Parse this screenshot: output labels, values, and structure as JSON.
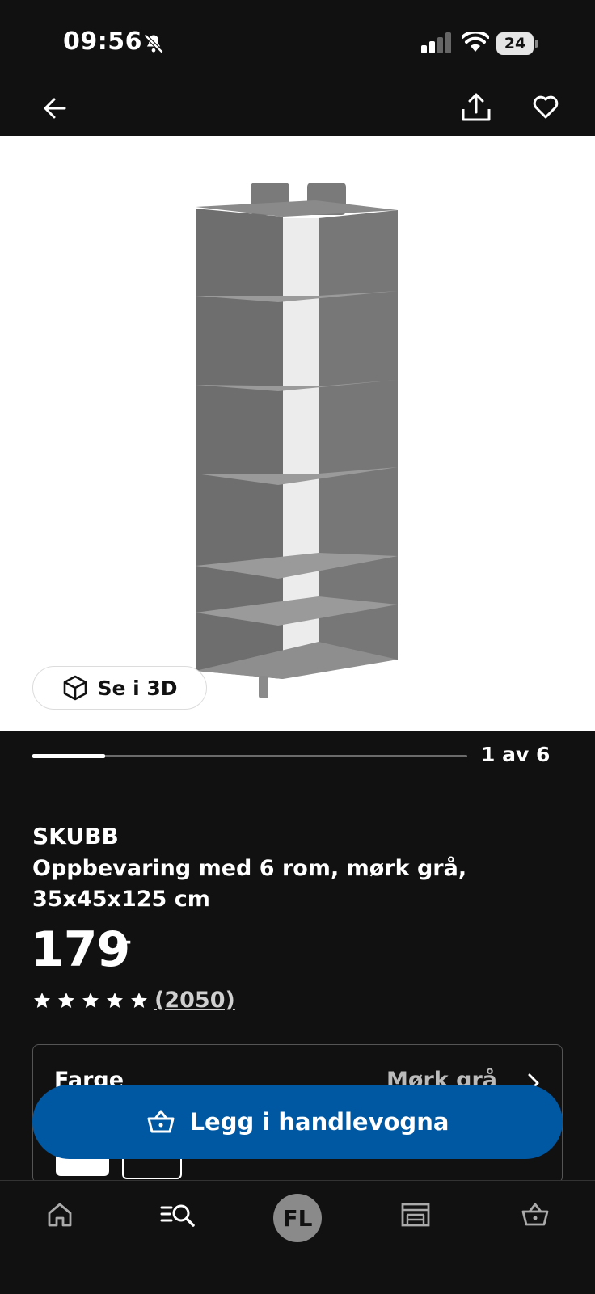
{
  "status_bar": {
    "time": "09:56",
    "battery": "24"
  },
  "image": {
    "view_3d_label": "Se i 3D"
  },
  "carousel": {
    "counter": "1 av 6",
    "progress": 0.167
  },
  "product": {
    "brand": "SKUBB",
    "description": "Oppbevaring med 6 rom, mørk grå, 35x45x125 cm",
    "price": "179",
    "price_suffix": ",-",
    "rating": 5,
    "review_count": "(2050)"
  },
  "color_selector": {
    "label": "Farge",
    "value": "Mørk grå"
  },
  "cart_button": {
    "label": "Legg i handlevogna"
  },
  "bottom_nav": {
    "profile_initials": "FL"
  }
}
